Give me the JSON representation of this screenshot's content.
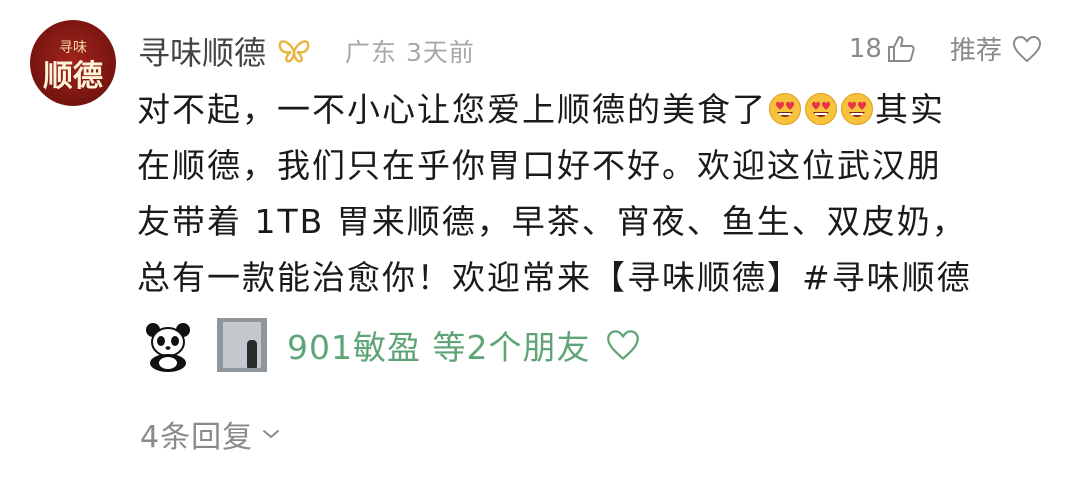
{
  "comment": {
    "author": {
      "name": "寻味顺德",
      "avatar_text_top": "寻味",
      "avatar_text_main": "顺德"
    },
    "meta": "广东 3天前",
    "likes": "18",
    "recommend_label": "推荐",
    "content": {
      "line1_before": "对不起，一不小心让您爱上顺德的美食了",
      "line1_after": "其实",
      "line2": "在顺德，我们只在乎你胃口好不好。欢迎这位武汉朋",
      "line3": "友带着 1TB 胃来顺德，早茶、宵夜、鱼生、双皮奶，",
      "line4": "总有一款能治愈你！欢迎常来【寻味顺德】#寻味顺德"
    },
    "friends_liked": "901敏盈 等2个朋友",
    "replies": "4条回复"
  },
  "colors": {
    "friend_green": "#5fa476",
    "meta_gray": "#a8a8a8",
    "avatar_red": "#7c1611"
  },
  "icons": [
    "vip-butterfly-icon",
    "thumbs-up-icon",
    "heart-outline-icon",
    "heart-eyes-emoji",
    "chevron-down-icon"
  ]
}
